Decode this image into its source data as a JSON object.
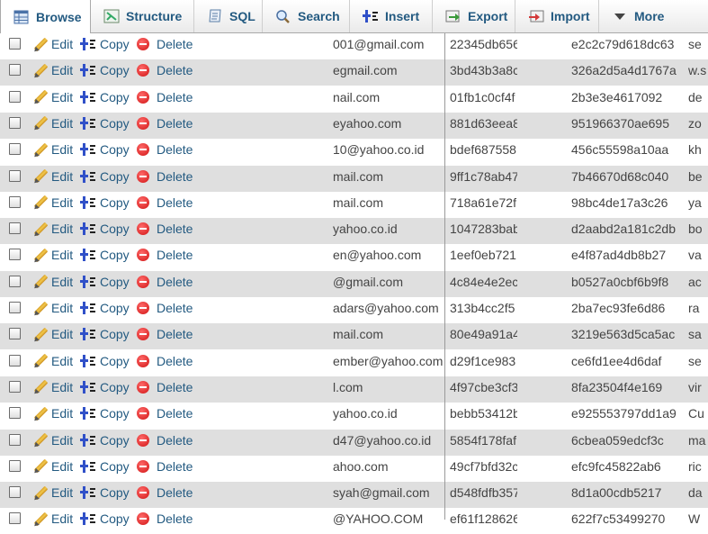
{
  "tabs": [
    {
      "label": "Browse",
      "icon": "table-icon",
      "active": true
    },
    {
      "label": "Structure",
      "icon": "structure-icon",
      "active": false
    },
    {
      "label": "SQL",
      "icon": "sql-icon",
      "active": false
    },
    {
      "label": "Search",
      "icon": "search-icon",
      "active": false
    },
    {
      "label": "Insert",
      "icon": "insert-icon",
      "active": false
    },
    {
      "label": "Export",
      "icon": "export-icon",
      "active": false
    },
    {
      "label": "Import",
      "icon": "import-icon",
      "active": false
    },
    {
      "label": "More",
      "icon": "chevron-down-icon",
      "active": false
    }
  ],
  "actions": {
    "edit": "Edit",
    "copy": "Copy",
    "delete": "Delete"
  },
  "rows": [
    {
      "email": "001@gmail.com",
      "hash1": "22345db656",
      "hash2": "e2c2c79d618dc63",
      "name": "se"
    },
    {
      "email": "egmail.com",
      "hash1": "3bd43b3a8c",
      "hash2": "326a2d5a4d1767a",
      "name": "w.s"
    },
    {
      "email": "nail.com",
      "hash1": "01fb1c0cf4f",
      "hash2": "2b3e3e4617092",
      "name": "de"
    },
    {
      "email": "eyahoo.com",
      "hash1": "881d63eea8",
      "hash2": "951966370ae695",
      "name": "zo"
    },
    {
      "email": "10@yahoo.co.id",
      "hash1": "bdef687558",
      "hash2": "456c55598a10aa",
      "name": "kh"
    },
    {
      "email": "mail.com",
      "hash1": "9ff1c78ab47",
      "hash2": "7b46670d68c040",
      "name": "be"
    },
    {
      "email": "mail.com",
      "hash1": "718a61e72f",
      "hash2": "98bc4de17a3c26",
      "name": "ya"
    },
    {
      "email": "yahoo.co.id",
      "hash1": "1047283bab",
      "hash2": "d2aabd2a181c2db",
      "name": "bo"
    },
    {
      "email": "en@yahoo.com",
      "hash1": "1eef0eb721",
      "hash2": "e4f87ad4db8b27",
      "name": "va"
    },
    {
      "email": "@gmail.com",
      "hash1": "4c84e4e2ec",
      "hash2": "b0527a0cbf6b9f8",
      "name": "ac"
    },
    {
      "email": "adars@yahoo.com",
      "hash1": "313b4cc2f5",
      "hash2": "2ba7ec93fe6d86",
      "name": "ra"
    },
    {
      "email": "mail.com",
      "hash1": "80e49a91a4",
      "hash2": "3219e563d5ca5ac",
      "name": "sa"
    },
    {
      "email": "ember@yahoo.com",
      "hash1": "d29f1ce983",
      "hash2": "ce6fd1ee4d6daf",
      "name": "se"
    },
    {
      "email": "l.com",
      "hash1": "4f97cbe3cf3",
      "hash2": "8fa23504f4e169",
      "name": "vir"
    },
    {
      "email": "yahoo.co.id",
      "hash1": "bebb53412b",
      "hash2": "e925553797dd1a9",
      "name": "Cu"
    },
    {
      "email": "d47@yahoo.co.id",
      "hash1": "5854f178faf",
      "hash2": "6cbea059edcf3c",
      "name": "ma"
    },
    {
      "email": "ahoo.com",
      "hash1": "49cf7bfd32c",
      "hash2": "efc9fc45822ab6",
      "name": "ric"
    },
    {
      "email": "syah@gmail.com",
      "hash1": "d548fdfb357",
      "hash2": "8d1a00cdb5217",
      "name": "da"
    },
    {
      "email": "@YAHOO.COM",
      "hash1": "ef61f128626",
      "hash2": "622f7c53499270",
      "name": "W"
    }
  ]
}
